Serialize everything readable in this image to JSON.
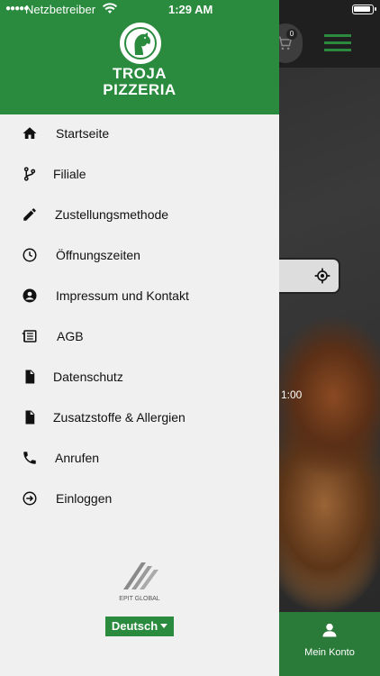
{
  "status_bar": {
    "carrier": "Netzbetreiber",
    "time": "1:29 AM"
  },
  "brand": {
    "line1": "TROJA",
    "line2": "PIZZERIA"
  },
  "menu": [
    {
      "label": "Startseite",
      "icon": "home-icon"
    },
    {
      "label": "Filiale",
      "icon": "branch-icon"
    },
    {
      "label": "Zustellungsmethode",
      "icon": "pencil-icon"
    },
    {
      "label": "Öffnungszeiten",
      "icon": "clock-icon"
    },
    {
      "label": "Impressum und Kontakt",
      "icon": "account-circle-icon"
    },
    {
      "label": "AGB",
      "icon": "newspaper-icon"
    },
    {
      "label": "Datenschutz",
      "icon": "file-icon"
    },
    {
      "label": "Zusatzstoffe & Allergien",
      "icon": "file-icon"
    },
    {
      "label": "Anrufen",
      "icon": "phone-icon"
    },
    {
      "label": "Einloggen",
      "icon": "login-icon"
    }
  ],
  "footer": {
    "company": "EPIT GLOBAL",
    "language": "Deutsch"
  },
  "background": {
    "cart_count": "0",
    "time_label": "1:00",
    "account_label": "Mein Konto"
  },
  "colors": {
    "brand_green": "#2a8a3e",
    "drawer_bg": "#f0f0f0"
  }
}
